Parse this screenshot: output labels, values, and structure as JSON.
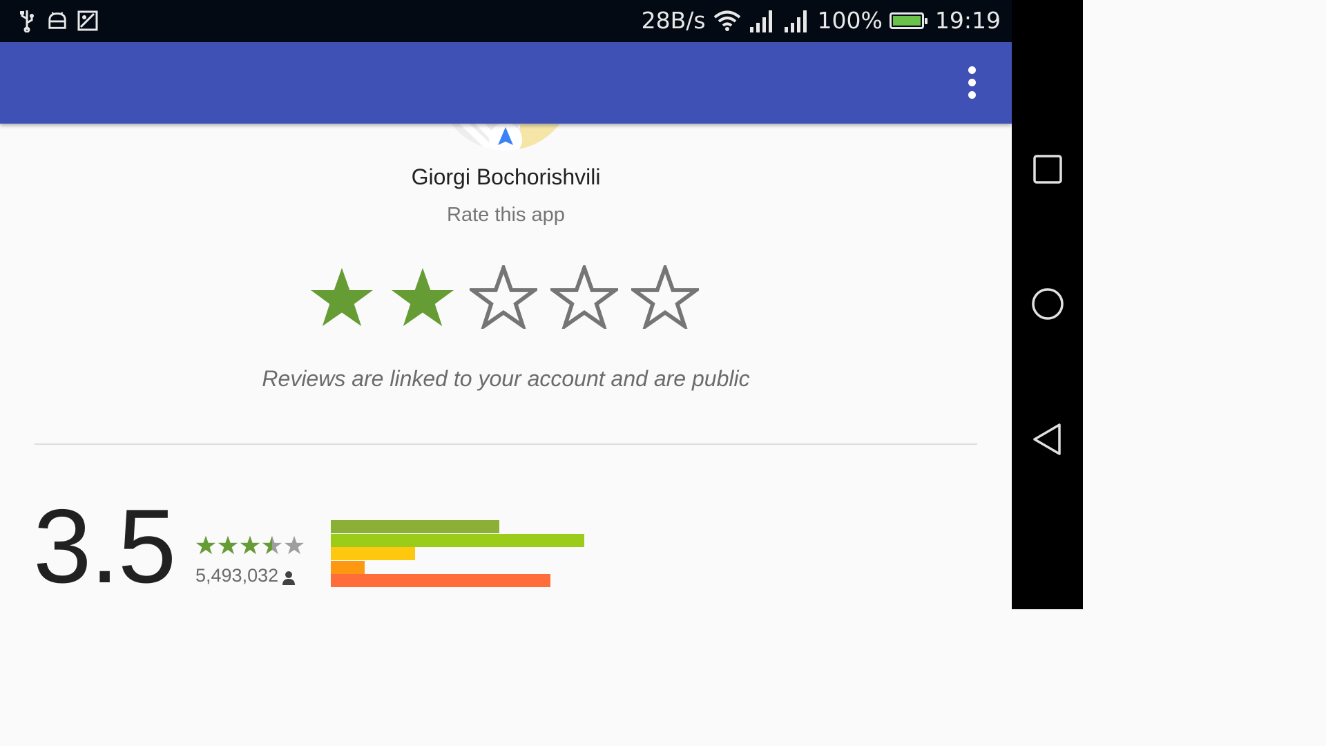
{
  "status_bar": {
    "net_speed": "28B/s",
    "battery_pct": "100%",
    "time": "19:19",
    "left_icons": [
      "usb-icon",
      "android-debug-icon",
      "image-icon"
    ]
  },
  "app_bar": {
    "color": "#3f51b5",
    "overflow_icon": "more-vert-icon"
  },
  "review": {
    "user_name": "Giorgi Bochorishvili",
    "prompt": "Rate this app",
    "selected_stars": 2,
    "max_stars": 5,
    "disclaimer": "Reviews are linked to your account and are public"
  },
  "summary": {
    "average": "3.5",
    "average_value": 3.5,
    "review_count": "5,493,032",
    "histogram": [
      {
        "stars": 5,
        "fraction": 0.666,
        "color": "#8bb035"
      },
      {
        "stars": 4,
        "fraction": 1.0,
        "color": "#9ccc1a"
      },
      {
        "stars": 3,
        "fraction": 0.333,
        "color": "#fec810"
      },
      {
        "stars": 2,
        "fraction": 0.133,
        "color": "#ff9811"
      },
      {
        "stars": 1,
        "fraction": 0.866,
        "color": "#ff6e3a"
      }
    ]
  },
  "colors": {
    "star_filled": "#659c34",
    "star_empty": "#757575"
  }
}
